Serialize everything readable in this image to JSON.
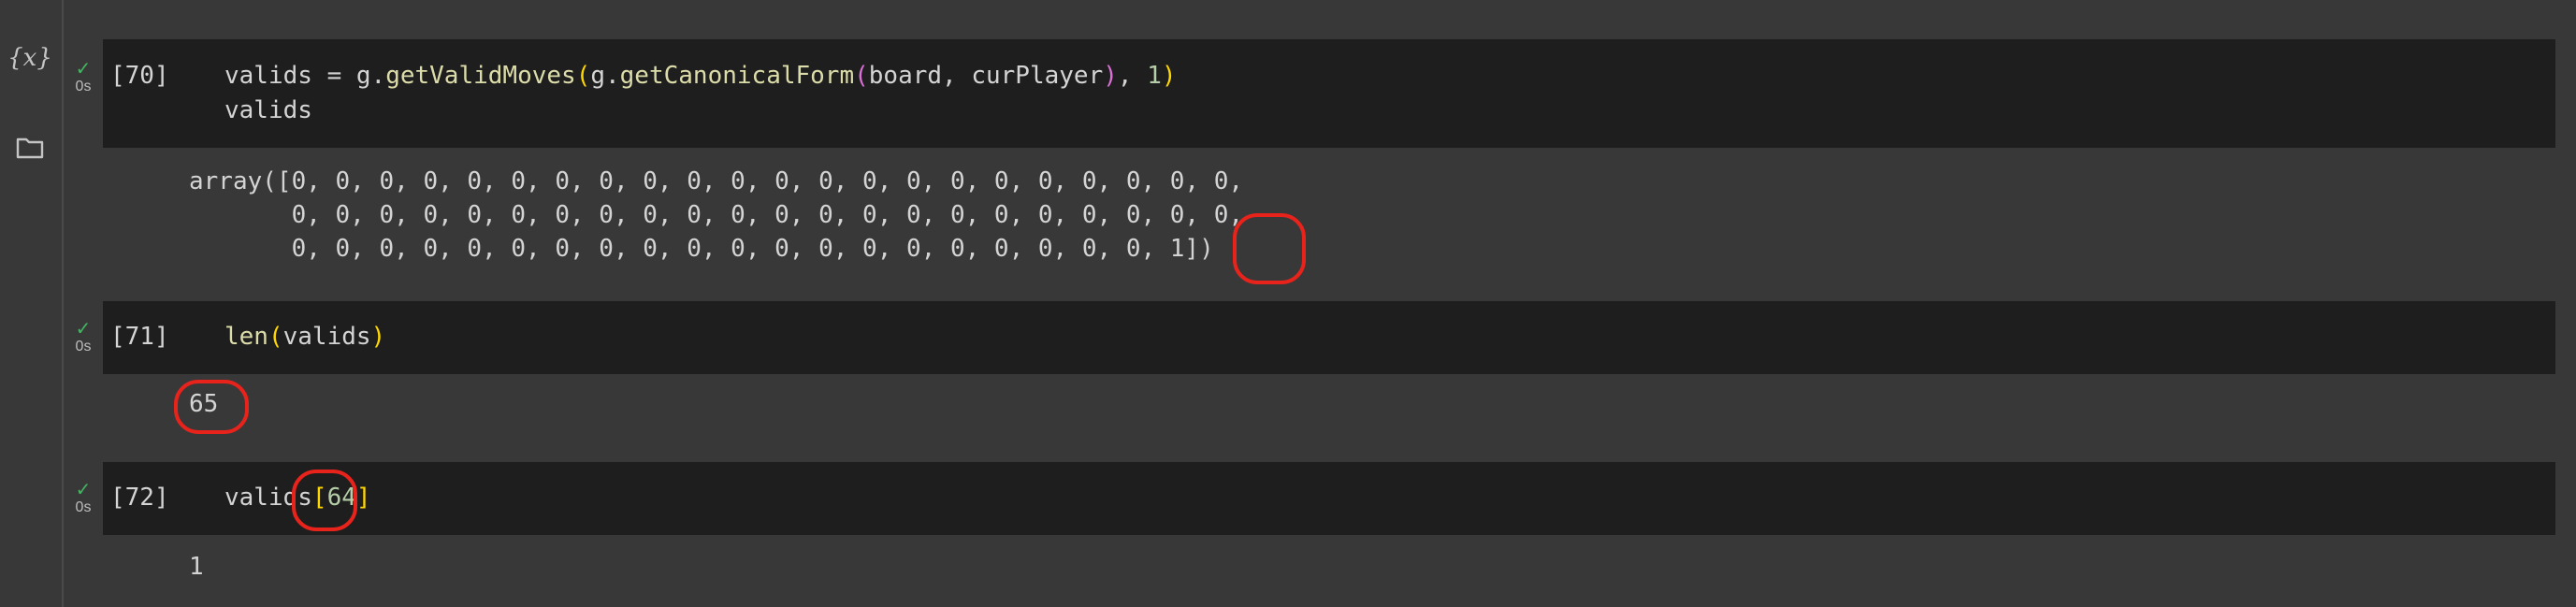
{
  "sidebar": {
    "variables_label": "{x}",
    "variables_icon": "variables-icon",
    "files_icon": "folder-icon"
  },
  "cells": [
    {
      "exec_count": "[70]",
      "status_time": "0s",
      "code_lines": [
        [
          "valids = g.",
          "getValidMoves",
          "(",
          "g.",
          "getCanonicalForm",
          "(",
          "board, curPlayer",
          ")",
          ", ",
          "1",
          ")"
        ],
        [
          "valids"
        ]
      ],
      "output": [
        "array([0, 0, 0, 0, 0, 0, 0, 0, 0, 0, 0, 0, 0, 0, 0, 0, 0, 0, 0, 0, 0, 0,",
        "       0, 0, 0, 0, 0, 0, 0, 0, 0, 0, 0, 0, 0, 0, 0, 0, 0, 0, 0, 0, 0, 0,",
        "       0, 0, 0, 0, 0, 0, 0, 0, 0, 0, 0, 0, 0, 0, 0, 0, 0, 0, 0, 0, 1])"
      ]
    },
    {
      "exec_count": "[71]",
      "status_time": "0s",
      "code_tokens": [
        "len",
        "(",
        "valids",
        ")"
      ],
      "output": "65"
    },
    {
      "exec_count": "[72]",
      "status_time": "0s",
      "code_tokens": [
        "valids",
        "[",
        "64",
        "]"
      ],
      "output": "1"
    }
  ],
  "colors": {
    "background": "#383838",
    "code_background": "#1e1e1e",
    "text": "#d4d4d4",
    "function": "#dcdcaa",
    "bracket_level1": "#ffd700",
    "bracket_level2": "#da70d6",
    "number": "#b5cea8",
    "success_check": "#42b561",
    "annotation": "#e8231b"
  }
}
